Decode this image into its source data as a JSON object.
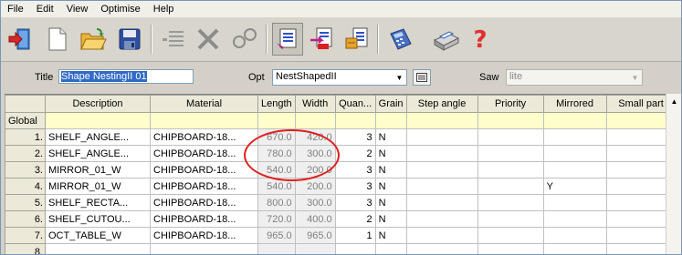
{
  "menu": [
    "File",
    "Edit",
    "View",
    "Optimise",
    "Help"
  ],
  "form": {
    "title_label": "Title",
    "title_value": "Shape NestingII 01",
    "opt_label": "Opt",
    "opt_value": "NestShapedII",
    "saw_label": "Saw",
    "saw_value": "lite"
  },
  "grid": {
    "columns": [
      "",
      "Description",
      "Material",
      "Length",
      "Width",
      "Quan...",
      "Grain",
      "Step angle",
      "Priority",
      "Mirrored",
      "Small part"
    ],
    "global_label": "Global",
    "rows": [
      {
        "n": "1.",
        "desc": "SHELF_ANGLE...",
        "mat": "CHIPBOARD-18...",
        "len": "670.0",
        "wid": "420.0",
        "qty": "3",
        "grain": "N",
        "step": "",
        "prio": "",
        "mir": "",
        "small": ""
      },
      {
        "n": "2.",
        "desc": "SHELF_ANGLE...",
        "mat": "CHIPBOARD-18...",
        "len": "780.0",
        "wid": "300.0",
        "qty": "2",
        "grain": "N",
        "step": "",
        "prio": "",
        "mir": "",
        "small": ""
      },
      {
        "n": "3.",
        "desc": "MIRROR_01_W",
        "mat": "CHIPBOARD-18...",
        "len": "540.0",
        "wid": "200.0",
        "qty": "3",
        "grain": "N",
        "step": "",
        "prio": "",
        "mir": "",
        "small": ""
      },
      {
        "n": "4.",
        "desc": "MIRROR_01_W",
        "mat": "CHIPBOARD-18...",
        "len": "540.0",
        "wid": "200.0",
        "qty": "3",
        "grain": "N",
        "step": "",
        "prio": "",
        "mir": "Y",
        "small": ""
      },
      {
        "n": "5.",
        "desc": "SHELF_RECTA...",
        "mat": "CHIPBOARD-18...",
        "len": "800.0",
        "wid": "300.0",
        "qty": "3",
        "grain": "N",
        "step": "",
        "prio": "",
        "mir": "",
        "small": ""
      },
      {
        "n": "6.",
        "desc": "SHELF_CUTOU...",
        "mat": "CHIPBOARD-18...",
        "len": "720.0",
        "wid": "400.0",
        "qty": "2",
        "grain": "N",
        "step": "",
        "prio": "",
        "mir": "",
        "small": ""
      },
      {
        "n": "7.",
        "desc": "OCT_TABLE_W",
        "mat": "CHIPBOARD-18...",
        "len": "965.0",
        "wid": "965.0",
        "qty": "1",
        "grain": "N",
        "step": "",
        "prio": "",
        "mir": "",
        "small": ""
      },
      {
        "n": "8.",
        "desc": "",
        "mat": "",
        "len": "",
        "wid": "",
        "qty": "",
        "grain": "",
        "step": "",
        "prio": "",
        "mir": "",
        "small": ""
      }
    ]
  },
  "toolbar_icons": [
    "exit-icon",
    "new-icon",
    "open-folder-icon",
    "save-disk-icon",
    "list-icon",
    "delete-x-icon",
    "link-icon",
    "parts-list-icon",
    "import-icon",
    "report-icon",
    "calculator-icon",
    "print-icon",
    "help-icon"
  ],
  "colors": {
    "global_row": "#ffffcc",
    "annotation": "#e02020",
    "selection": "#316ac5"
  }
}
